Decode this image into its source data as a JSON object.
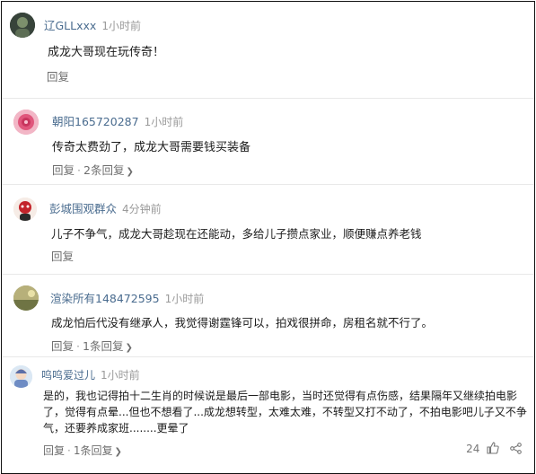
{
  "comments": [
    {
      "username": "辽GLLxxx",
      "time": "1小时前",
      "text": "成龙大哥现在玩传奇！",
      "reply_label": "回复",
      "avatar": "dark-green-avatar"
    },
    {
      "username": "朝阳165720287",
      "time": "1小时前",
      "text": "传奇太费劲了，成龙大哥需要钱买装备",
      "reply_label": "回复",
      "reply_count": "2条回复",
      "avatar": "pink-rose-avatar"
    },
    {
      "username": "彭城围观群众",
      "time": "4分钟前",
      "text": "儿子不争气，成龙大哥趁现在还能动，多给儿子攒点家业，顺便赚点养老钱",
      "reply_label": "回复",
      "avatar": "red-mascot-avatar"
    },
    {
      "username": "渲染所有148472595",
      "time": "1小时前",
      "text": "成龙怕后代没有继承人，我觉得谢霆锋可以，拍戏很拼命，房租名就不行了。",
      "reply_label": "回复",
      "reply_count": "1条回复",
      "avatar": "olive-landscape-avatar"
    },
    {
      "username": "呜呜爱过儿",
      "time": "1小时前",
      "text": "是的，我也记得拍十二生肖的时候说是最后一部电影，当时还觉得有点伤感，结果隔年又继续拍电影了，觉得有点晕...但也不想看了...成龙想转型，太难太难，不转型又打不动了，不拍电影吧儿子又不争气，还要养成家班........更晕了",
      "reply_label": "回复",
      "reply_count": "1条回复",
      "likes": "24",
      "avatar": "blue-character-avatar"
    }
  ],
  "icons": {
    "chevron": "chevron-down-icon",
    "thumb": "thumbs-up-icon",
    "share": "share-icon"
  },
  "colors": {
    "username": "#4a6c8f",
    "time": "#9a9a9a",
    "action": "#6e6e6e",
    "text": "#1a1a1a"
  }
}
